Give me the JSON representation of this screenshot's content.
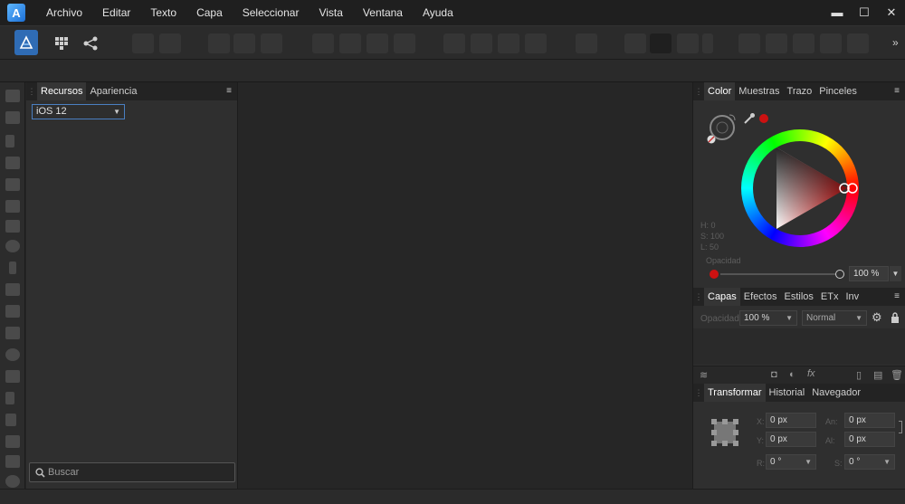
{
  "menubar": {
    "items": [
      "Archivo",
      "Editar",
      "Texto",
      "Capa",
      "Seleccionar",
      "Vista",
      "Ventana",
      "Ayuda"
    ],
    "minimize": "▬",
    "maximize": "☐",
    "close": "✕"
  },
  "toolbar": {
    "persona_icon": "affinity-designer-icon",
    "overflow": "»"
  },
  "left_panel": {
    "tabs": [
      "Recursos",
      "Apariencia"
    ],
    "menu": "≡",
    "category": {
      "selected": "iOS 12"
    },
    "search": {
      "placeholder": "Buscar"
    }
  },
  "color_panel": {
    "tabs": [
      "Color",
      "Muestras",
      "Trazo",
      "Pinceles"
    ],
    "menu": "≡",
    "hsl": {
      "h": "H: 0",
      "s": "S: 100",
      "l": "L: 50"
    },
    "opacity_label": "Opacidad",
    "opacity_value": "100 %",
    "current_color": "#cc1111"
  },
  "layers_panel": {
    "tabs": [
      "Capas",
      "Efectos",
      "Estilos",
      "ETx",
      "Inv"
    ],
    "menu": "≡",
    "opacity_label": "Opacidad:",
    "opacity_value": "100 %",
    "blend_mode": "Normal"
  },
  "transform_panel": {
    "tabs": [
      "Transformar",
      "Historial",
      "Navegador"
    ],
    "x": {
      "label": "X:",
      "value": "0 px"
    },
    "y": {
      "label": "Y:",
      "value": "0 px"
    },
    "w": {
      "label": "An:",
      "value": "0 px"
    },
    "h": {
      "label": "Al:",
      "value": "0 px"
    },
    "r": {
      "label": "R:",
      "value": "0 °"
    },
    "s": {
      "label": "S:",
      "value": "0 °"
    }
  },
  "colors": {
    "accent": "#2f6cb5",
    "panel_bg": "#2f2f2f",
    "canvas_bg": "#262626"
  }
}
